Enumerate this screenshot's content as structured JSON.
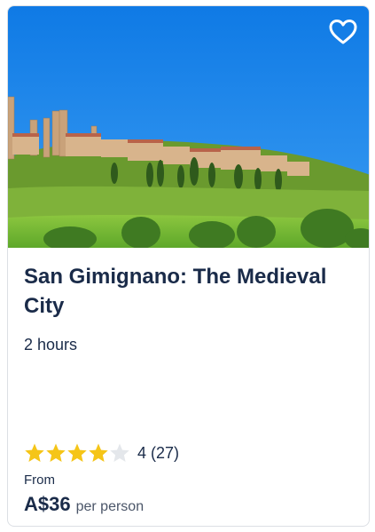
{
  "card": {
    "title": "San Gimignano: The Medieval City",
    "duration": "2 hours",
    "rating": {
      "value": "4",
      "count": "(27)",
      "stars": 4,
      "max_stars": 5,
      "star_color": "#f5c518",
      "star_empty_color": "#e4e7eb"
    },
    "price": {
      "from_label": "From",
      "amount": "A$36",
      "unit": "per person"
    },
    "wishlist_icon": "heart-outline-icon",
    "image_subject": "medieval hill town with towers"
  },
  "colors": {
    "text": "#1a2b49",
    "border": "#dcdfe4",
    "sky": "#1a86e8"
  }
}
